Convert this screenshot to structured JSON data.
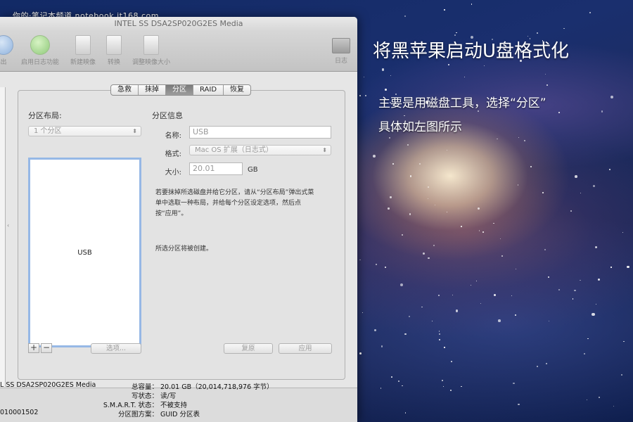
{
  "watermark": "你的·笔记本频道 notebook.it168.com",
  "headline": "将黑苹果启动U盘格式化",
  "description": {
    "line1": "主要是用磁盘工具，选择“分区”",
    "line2": "具体如左图所示"
  },
  "window": {
    "title": "INTEL SS DSA2SP020G2ES Media",
    "toolbar": {
      "items": [
        {
          "label": "出",
          "icon": "eject-icon"
        },
        {
          "label": "启用日志功能",
          "icon": "enable-journal-icon"
        },
        {
          "label": "新建映像",
          "icon": "new-image-icon"
        },
        {
          "label": "转换",
          "icon": "convert-icon"
        },
        {
          "label": "调整映像大小",
          "icon": "resize-image-icon"
        },
        {
          "label": "日志",
          "icon": "log-icon"
        }
      ]
    },
    "tabs": [
      "急救",
      "抹掉",
      "分区",
      "RAID",
      "恢复"
    ],
    "active_tab": "分区",
    "partition_layout": {
      "title": "分区布局:",
      "select_value": "1 个分区",
      "box_label": "USB",
      "add_label": "+",
      "remove_label": "−",
      "options_button": "选项..."
    },
    "partition_info": {
      "title": "分区信息",
      "name_label": "名称:",
      "name_value": "USB",
      "format_label": "格式:",
      "format_value": "Mac OS 扩展（日志式）",
      "size_label": "大小:",
      "size_value": "20.01",
      "size_unit": "GB",
      "note_line1": "若要抹掉所选磁盘并给它分区，请从“分区布局”弹出式菜",
      "note_line2": "单中选取一种布局，并给每个分区设定选项，然后点",
      "note_line3": "按“应用”。",
      "status": "所选分区将被创建。",
      "revert_button": "复原",
      "apply_button": "应用"
    },
    "info": {
      "disk_name": "L SS DSA2SP020G2ES Media",
      "disk_id": "010001502",
      "capacity_label": "总容量：",
      "capacity_value": "20.01 GB（20,014,718,976 字节）",
      "write_label": "写状态：",
      "write_value": "读/写",
      "smart_label": "S.M.A.R.T. 状态：",
      "smart_value": "不被支持",
      "scheme_label": "分区图方案：",
      "scheme_value": "GUID 分区表"
    }
  },
  "colors": {
    "selection_border": "#96b8e6",
    "window_bg": "#e6e6e6",
    "active_tab": "#7a7a7a"
  }
}
